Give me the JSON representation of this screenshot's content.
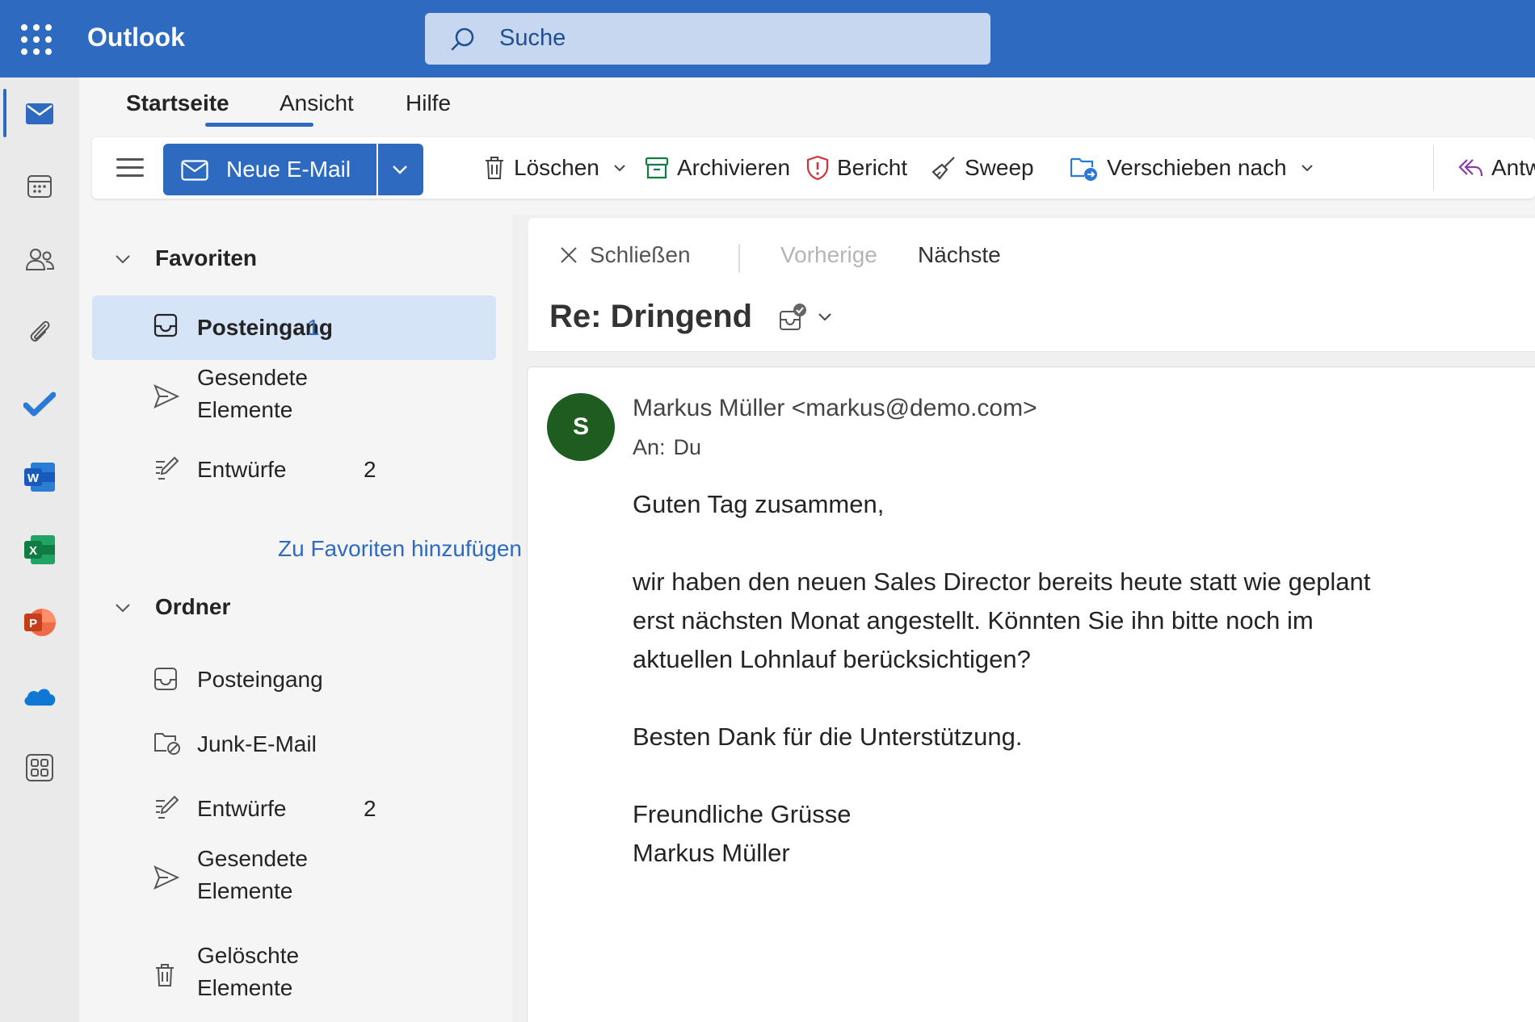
{
  "app": {
    "title": "Outlook"
  },
  "search": {
    "placeholder": "Suche"
  },
  "tabs": [
    {
      "label": "Startseite",
      "active": true
    },
    {
      "label": "Ansicht"
    },
    {
      "label": "Hilfe"
    }
  ],
  "toolbar": {
    "new_mail": "Neue E-Mail",
    "delete": "Löschen",
    "archive": "Archivieren",
    "report": "Bericht",
    "sweep": "Sweep",
    "move_to": "Verschieben nach",
    "reply": "Antworten"
  },
  "folders": {
    "favorites_header": "Favoriten",
    "favorites": [
      {
        "label": "Posteingang",
        "count": "1"
      },
      {
        "label": "Gesendete Elemente",
        "count": ""
      },
      {
        "label": "Entwürfe",
        "count": "2"
      }
    ],
    "add_favorite": "Zu Favoriten hinzufügen",
    "folders_header": "Ordner",
    "folders": [
      {
        "label": "Posteingang",
        "count": ""
      },
      {
        "label": "Junk-E-Mail",
        "count": ""
      },
      {
        "label": "Entwürfe",
        "count": "2"
      },
      {
        "label": "Gesendete Elemente",
        "count": ""
      },
      {
        "label": "Gelöschte Elemente",
        "count": ""
      }
    ]
  },
  "reading": {
    "close": "Schließen",
    "previous": "Vorherige",
    "next": "Nächste",
    "subject": "Re: Dringend"
  },
  "message": {
    "avatar_initial": "S",
    "sender": "Markus Müller <markus@demo.com>",
    "to_label": "An:",
    "to_value": "Du",
    "greeting": "Guten Tag zusammen,",
    "body_lines": [
      "wir haben den neuen Sales Director bereits heute statt wie geplant",
      "erst nächsten Monat angestellt. Könnten Sie ihn bitte noch im",
      "aktuellen Lohnlauf berücksichtigen?"
    ],
    "thanks": "Besten Dank für die Unterstützung.",
    "closing": "Freundliche Grüsse",
    "signature": "Markus Müller"
  },
  "rail_icons": [
    "mail-icon",
    "calendar-icon",
    "people-icon",
    "attachment-icon",
    "todo-icon",
    "word-icon",
    "excel-icon",
    "powerpoint-icon",
    "onedrive-icon",
    "apps-icon"
  ],
  "colors": {
    "brand": "#2e6bc0",
    "avatar": "#1f5c1f",
    "selected_folder": "#d6e4f7"
  }
}
